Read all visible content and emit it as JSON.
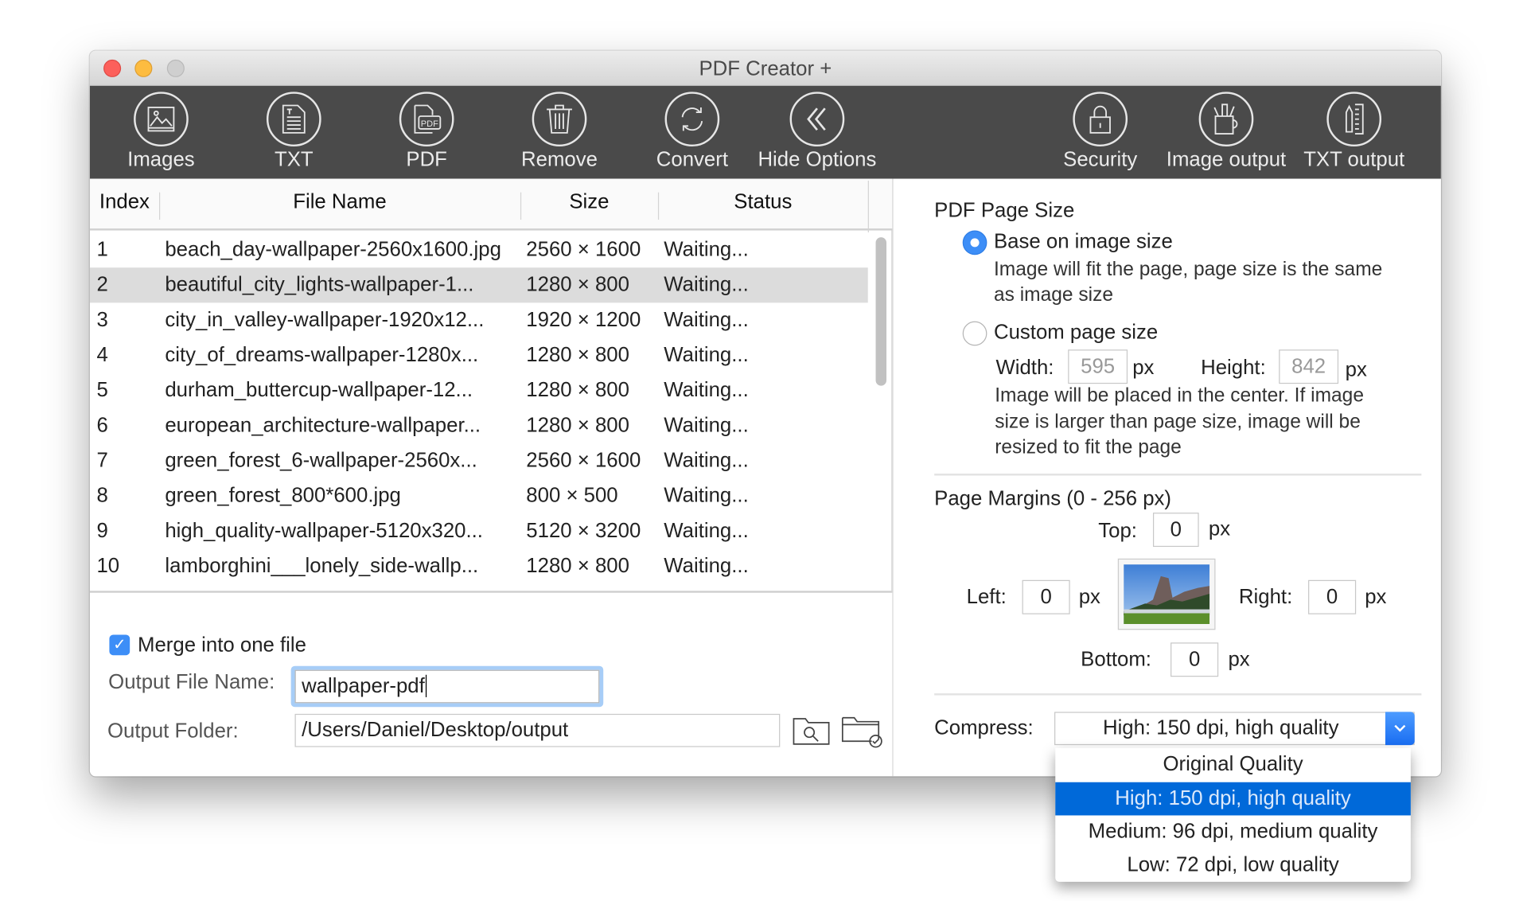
{
  "window": {
    "title": "PDF Creator +"
  },
  "toolbar": {
    "left": [
      {
        "label": "Images",
        "icon": "image-icon"
      },
      {
        "label": "TXT",
        "icon": "txt-document-icon"
      },
      {
        "label": "PDF",
        "icon": "pdf-document-icon"
      },
      {
        "label": "Remove",
        "icon": "trash-icon"
      },
      {
        "label": "Convert",
        "icon": "convert-arrows-icon"
      },
      {
        "label": "Hide Options",
        "icon": "double-chevron-left-icon"
      }
    ],
    "right": [
      {
        "label": "Security",
        "icon": "lock-icon"
      },
      {
        "label": "Image output",
        "icon": "art-cup-icon"
      },
      {
        "label": "TXT output",
        "icon": "pencil-ruler-icon"
      }
    ]
  },
  "table": {
    "headers": [
      "Index",
      "File Name",
      "Size",
      "Status"
    ],
    "rows": [
      {
        "index": "1",
        "name": "beach_day-wallpaper-2560x1600.jpg",
        "size": "2560 × 1600",
        "status": "Waiting..."
      },
      {
        "index": "2",
        "name": "beautiful_city_lights-wallpaper-1...",
        "size": "1280 × 800",
        "status": "Waiting..."
      },
      {
        "index": "3",
        "name": "city_in_valley-wallpaper-1920x12...",
        "size": "1920 × 1200",
        "status": "Waiting..."
      },
      {
        "index": "4",
        "name": "city_of_dreams-wallpaper-1280x...",
        "size": "1280 × 800",
        "status": "Waiting..."
      },
      {
        "index": "5",
        "name": "durham_buttercup-wallpaper-12...",
        "size": "1280 × 800",
        "status": "Waiting..."
      },
      {
        "index": "6",
        "name": "european_architecture-wallpaper...",
        "size": "1280 × 800",
        "status": "Waiting..."
      },
      {
        "index": "7",
        "name": "green_forest_6-wallpaper-2560x...",
        "size": "2560 × 1600",
        "status": "Waiting..."
      },
      {
        "index": "8",
        "name": "green_forest_800*600.jpg",
        "size": "800 × 500",
        "status": "Waiting..."
      },
      {
        "index": "9",
        "name": "high_quality-wallpaper-5120x320...",
        "size": "5120 × 3200",
        "status": "Waiting..."
      },
      {
        "index": "10",
        "name": "lamborghini___lonely_side-wallp...",
        "size": "1280 × 800",
        "status": "Waiting..."
      }
    ],
    "selected_index": 1
  },
  "output": {
    "merge_label": "Merge into one file",
    "merge_checked": true,
    "file_name_label": "Output File Name:",
    "file_name_value": "wallpaper-pdf",
    "folder_label": "Output Folder:",
    "folder_value": "/Users/Daniel/Desktop/output"
  },
  "page_size": {
    "title": "PDF Page Size",
    "option1": "Base on image size",
    "option1_desc1": "Image will fit the page, page size is the same",
    "option1_desc2": "as image size",
    "option2": "Custom page size",
    "width_label": "Width:",
    "width_value": "595",
    "height_label": "Height:",
    "height_value": "842",
    "unit": "px",
    "option2_desc1": "Image will be placed in the center. If image",
    "option2_desc2": "size is larger than page size, image will be",
    "option2_desc3": "resized to fit the page",
    "selected": "Base on image size"
  },
  "margins": {
    "title": "Page Margins (0 - 256 px)",
    "top_label": "Top:",
    "top": "0",
    "left_label": "Left:",
    "left": "0",
    "right_label": "Right:",
    "right": "0",
    "bottom_label": "Bottom:",
    "bottom": "0",
    "unit": "px"
  },
  "compress": {
    "label": "Compress:",
    "value": "High: 150 dpi, high quality",
    "options": [
      "Original Quality",
      "High: 150 dpi, high quality",
      "Medium: 96 dpi, medium quality",
      "Low: 72 dpi, low quality"
    ],
    "selected_index": 1
  },
  "colors": {
    "accent": "#0069d9",
    "toolbar": "#4a4a4a"
  }
}
